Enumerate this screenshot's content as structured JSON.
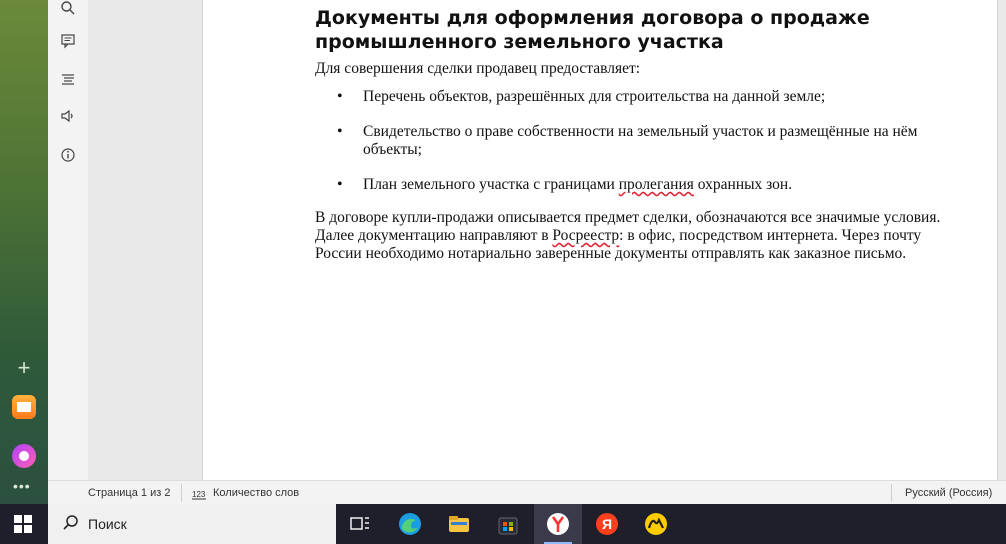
{
  "document": {
    "title": "Документы для оформления договора о продаже промышленного земельного участка",
    "intro": "Для совершения сделки продавец предоставляет:",
    "bullets": [
      {
        "text": "Перечень объектов, разрешённых для строительства на данной земле;"
      },
      {
        "text": "Свидетельство о праве собственности на земельный участок и размещённые на нём объекты;"
      },
      {
        "before": "План земельного участка с границами ",
        "underlined": "пролегания",
        "after": " охранных зон."
      }
    ],
    "paragraph": {
      "part1": "В договоре купли-продажи описывается предмет сделки, обозначаются все значимые условия. Далее документацию направляют в ",
      "underlined": "Росреестр",
      "part2": ": в офис, посредством интернета. Через почту России необходимо нотариально заверенные документы отправлять как заказное письмо."
    }
  },
  "statusbar": {
    "page": "Страница 1 из 2",
    "wordcount_icon": "word-count-icon",
    "wordcount": "Количество слов",
    "language": "Русский (Россия)"
  },
  "taskbar": {
    "search_text": "Поиск",
    "apps": [
      "task-view",
      "edge",
      "file-explorer",
      "store",
      "yandex-browser",
      "yandex",
      "yandex-market"
    ]
  },
  "colors": {
    "accent": "#2b5797",
    "spell_error": "#d23"
  }
}
